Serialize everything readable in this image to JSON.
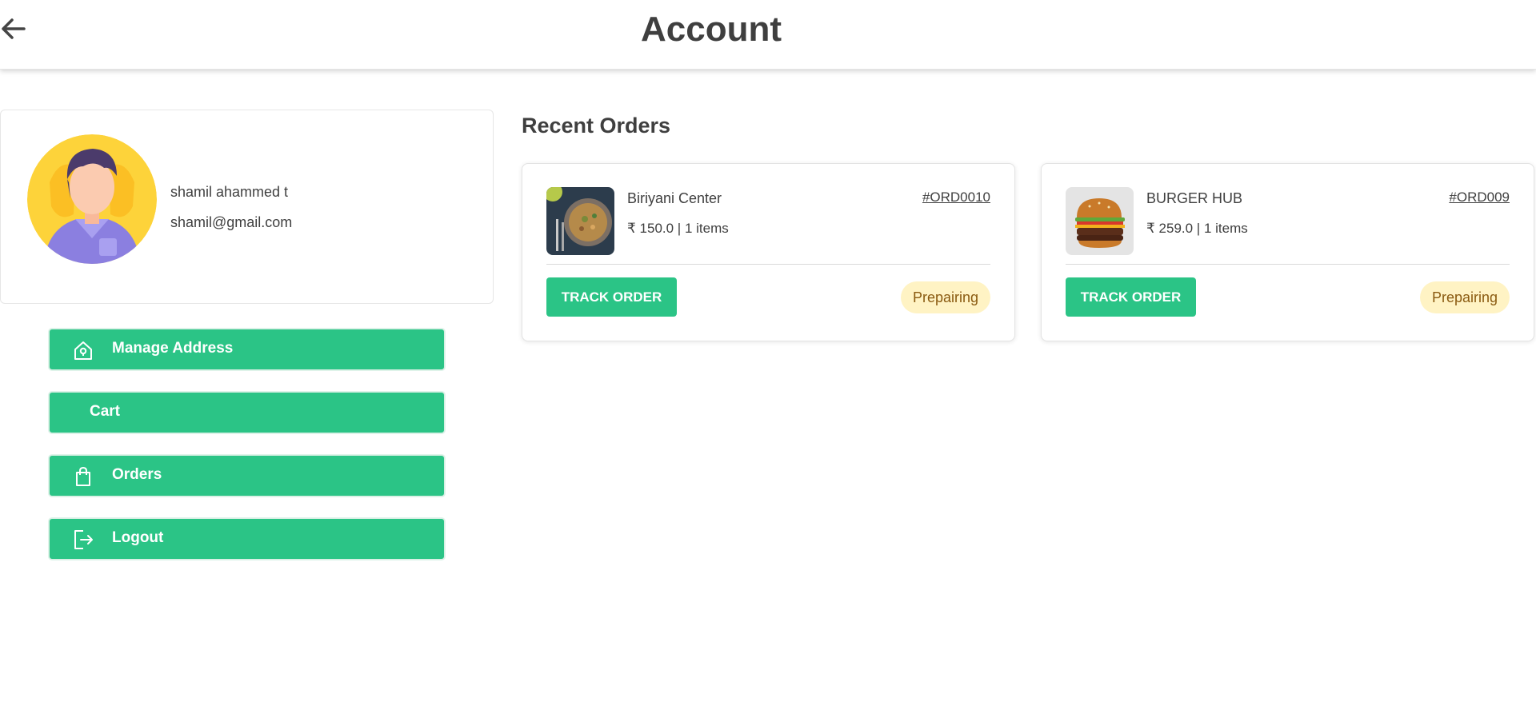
{
  "header": {
    "title": "Account",
    "back_icon": "arrow-left-icon"
  },
  "profile": {
    "name": "shamil ahammed t",
    "email": "shamil@gmail.com",
    "avatar_icon": "user-avatar"
  },
  "menu": [
    {
      "label": "Manage Address",
      "icon": "home-location-icon"
    },
    {
      "label": "Cart",
      "icon": ""
    },
    {
      "label": "Orders",
      "icon": "shopping-bag-icon"
    },
    {
      "label": "Logout",
      "icon": "logout-icon"
    }
  ],
  "recent_orders": {
    "title": "Recent Orders",
    "orders": [
      {
        "restaurant": "Biriyani Center",
        "summary": "₹ 150.0 | 1 items",
        "order_id": "#ORD0010",
        "action": "TRACK ORDER",
        "status": "Prepairing",
        "thumb": "biriyani-plate-image"
      },
      {
        "restaurant": "BURGER HUB",
        "summary": "₹ 259.0 | 1 items",
        "order_id": "#ORD009",
        "action": "TRACK ORDER",
        "status": "Prepairing",
        "thumb": "burger-image"
      }
    ]
  },
  "colors": {
    "accent": "#2bc486",
    "status_bg": "#fff3c4",
    "status_text": "#8a5a10",
    "text": "#3f3f3f"
  }
}
